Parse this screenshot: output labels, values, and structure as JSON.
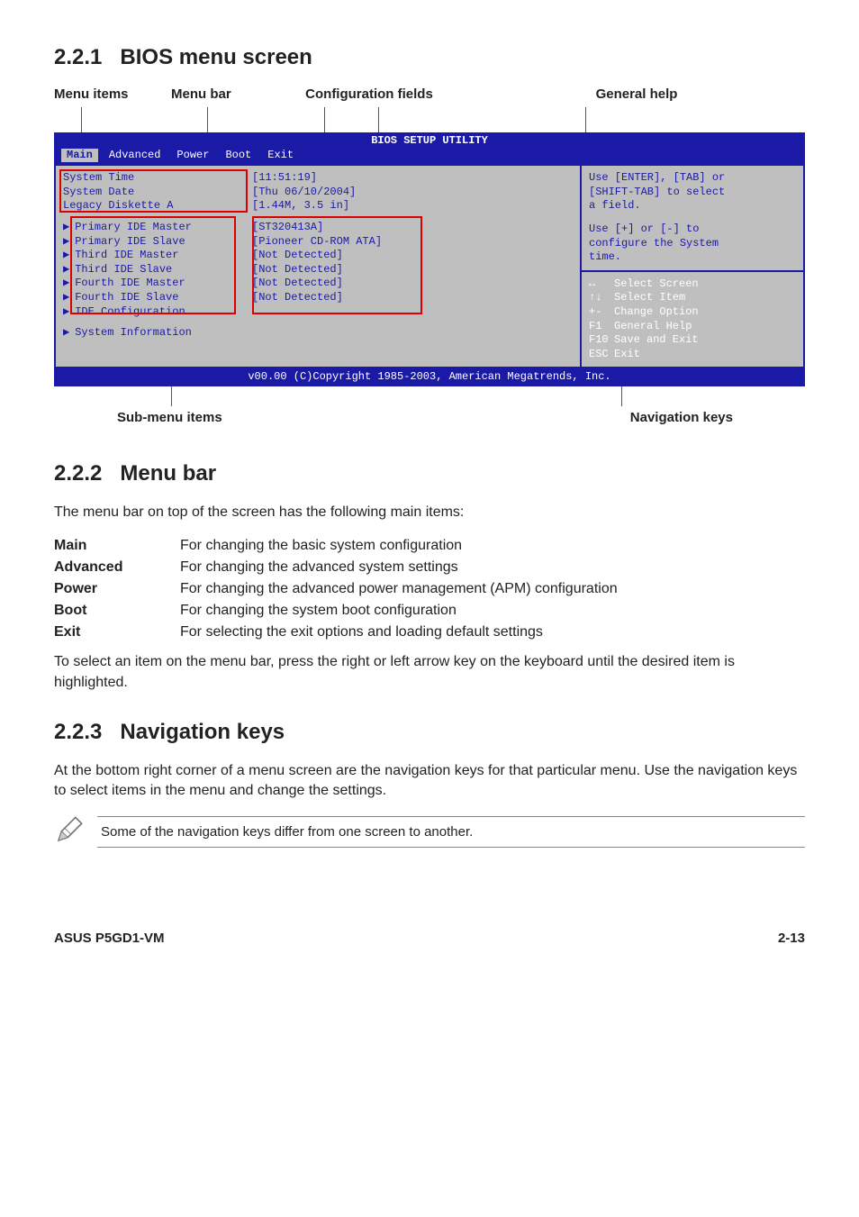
{
  "sections": {
    "s1": {
      "num": "2.2.1",
      "title": "BIOS menu screen"
    },
    "s2": {
      "num": "2.2.2",
      "title": "Menu bar"
    },
    "s3": {
      "num": "2.2.3",
      "title": "Navigation keys"
    }
  },
  "topLabels": {
    "menuItems": "Menu items",
    "menuBar": "Menu bar",
    "config": "Configuration fields",
    "general": "General help"
  },
  "bios": {
    "title": "BIOS SETUP UTILITY",
    "tabs": {
      "main": "Main",
      "advanced": "Advanced",
      "power": "Power",
      "boot": "Boot",
      "exit": "Exit"
    },
    "rows": {
      "sysTimeK": "System Time",
      "sysTimeV": "[11:51:19]",
      "sysDateK": "System Date",
      "sysDateV": "[Thu 06/10/2004]",
      "legacyK": "Legacy Diskette A",
      "legacyV": "[1.44M, 3.5 in]",
      "pimK": "Primary IDE Master",
      "pimV": "[ST320413A]",
      "pisK": "Primary IDE Slave",
      "pisV": "[Pioneer CD-ROM ATA]",
      "timK": "Third IDE Master",
      "timV": "[Not Detected]",
      "tisK": "Third IDE Slave",
      "tisV": "[Not Detected]",
      "fimK": "Fourth IDE Master",
      "fimV": "[Not Detected]",
      "fisK": "Fourth IDE Slave",
      "fisV": "[Not Detected]",
      "idecfg": "IDE Configuration",
      "sysinfo": "System Information"
    },
    "help": {
      "l1": "Use [ENTER], [TAB] or",
      "l2": "[SHIFT-TAB] to select",
      "l3": "a field.",
      "l4": "Use [+] or [-] to",
      "l5": "configure the System",
      "l6": "time."
    },
    "nav": {
      "k1": "↔",
      "v1": "Select Screen",
      "k2": "↑↓",
      "v2": "Select Item",
      "k3": "+-",
      "v3": "Change Option",
      "k4": "F1",
      "v4": "General Help",
      "k5": "F10",
      "v5": "Save and Exit",
      "k6": "ESC",
      "v6": "Exit"
    },
    "footer": "v00.00 (C)Copyright 1985-2003, American Megatrends, Inc."
  },
  "belowLabels": {
    "sub": "Sub-menu items",
    "nav": "Navigation keys"
  },
  "menuBarText": "The menu bar on top of the screen has the following main items:",
  "defs": {
    "main": {
      "term": "Main",
      "desc": "For changing the basic system configuration"
    },
    "advanced": {
      "term": "Advanced",
      "desc": "For changing the advanced system settings"
    },
    "power": {
      "term": "Power",
      "desc": "For changing the advanced power management (APM) configuration"
    },
    "boot": {
      "term": "Boot",
      "desc": "For changing the system boot configuration"
    },
    "exit": {
      "term": "Exit",
      "desc": "For selecting the exit options and loading default settings"
    }
  },
  "menuBarSelect": "To select an item on the menu bar, press the right or left arrow key on the keyboard until the desired item is highlighted.",
  "navKeysText": "At the bottom right corner of a menu screen are the navigation keys for that particular menu. Use the navigation keys to select items in the menu and change the settings.",
  "note": "Some of the navigation keys differ from one screen to another.",
  "pageFooter": {
    "left": "ASUS P5GD1-VM",
    "right": "2-13"
  }
}
